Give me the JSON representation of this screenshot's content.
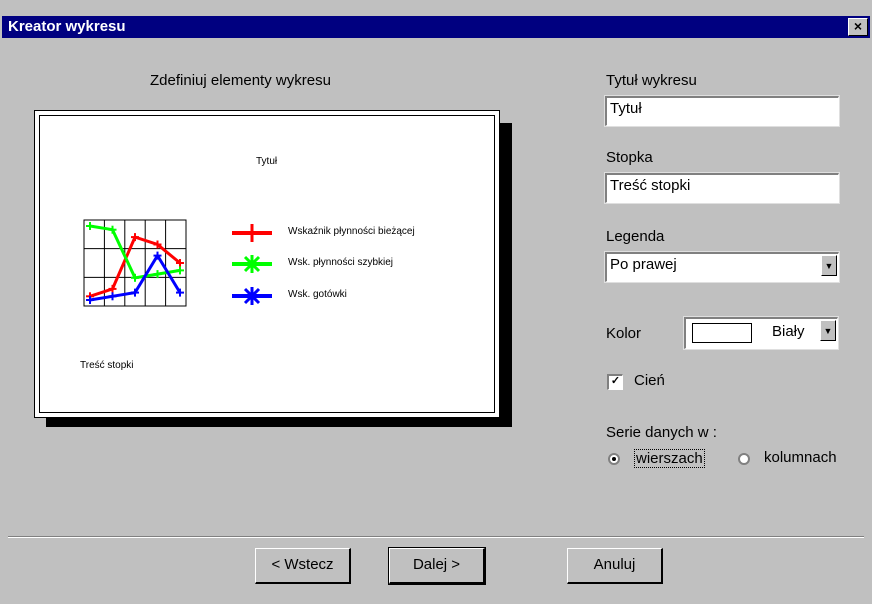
{
  "window": {
    "title": "Kreator wykresu",
    "close_label": "×"
  },
  "preview": {
    "caption": "Zdefiniuj elementy wykresu",
    "chart_title": "Tytuł",
    "chart_footer": "Treść stopki",
    "legend": [
      {
        "label": "Wskaźnik płynności bieżącej",
        "color": "#ff0000"
      },
      {
        "label": "Wsk. płynności szybkiej",
        "color": "#00ff00"
      },
      {
        "label": "Wsk. gotówki",
        "color": "#0000ff"
      }
    ]
  },
  "chart_data": {
    "type": "line",
    "series": [
      {
        "values": [
          0.05,
          0.15,
          0.85,
          0.75,
          0.5
        ]
      },
      {
        "values": [
          1.0,
          0.95,
          0.3,
          0.35,
          0.4
        ]
      },
      {
        "values": [
          0.0,
          0.05,
          0.1,
          0.6,
          0.1
        ]
      }
    ]
  },
  "form": {
    "title_label": "Tytuł wykresu",
    "title_value": "Tytuł",
    "footer_label": "Stopka",
    "footer_value": "Treść stopki",
    "legend_label": "Legenda",
    "legend_value": "Po prawej",
    "color_label": "Kolor",
    "color_value": "Biały",
    "color_swatch": "#ffffff",
    "shadow_label": "Cień",
    "shadow_checked": true,
    "series_label": "Serie danych w :",
    "series_rows": "wierszach",
    "series_cols": "kolumnach",
    "series_selected": "wierszach"
  },
  "buttons": {
    "back": "< Wstecz",
    "next": "Dalej >",
    "cancel": "Anuluj"
  }
}
